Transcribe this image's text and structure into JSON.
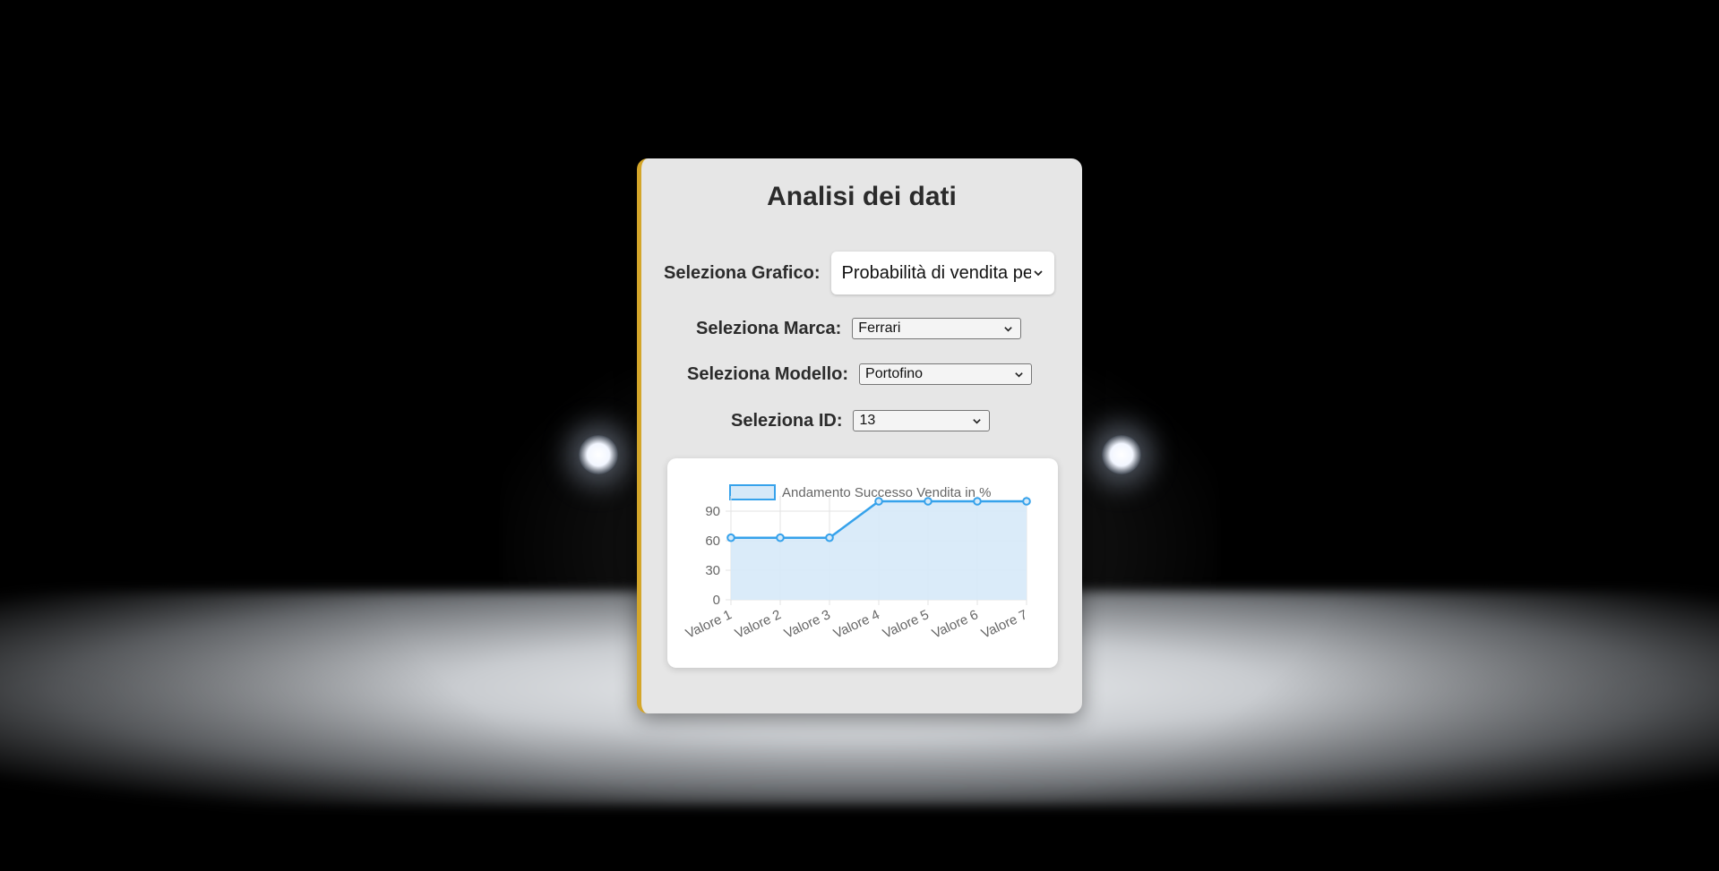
{
  "page": {
    "title": "Analisi dei dati"
  },
  "form": {
    "grafico": {
      "label": "Seleziona Grafico:",
      "value": "Probabilità di vendita pe"
    },
    "marca": {
      "label": "Seleziona Marca:",
      "value": "Ferrari"
    },
    "modello": {
      "label": "Seleziona Modello:",
      "value": "Portofino"
    },
    "id": {
      "label": "Seleziona ID:",
      "value": "13"
    }
  },
  "colors": {
    "accent": "#d4a62a",
    "line": "#36a2eb",
    "fill": "#d6e9f8"
  },
  "chart_data": {
    "type": "area",
    "categories": [
      "Valore 1",
      "Valore 2",
      "Valore 3",
      "Valore 4",
      "Valore 5",
      "Valore 6",
      "Valore 7"
    ],
    "series": [
      {
        "name": "Andamento Successo Vendita in %",
        "values": [
          63,
          63,
          63,
          100,
          100,
          100,
          100
        ]
      }
    ],
    "yticks": [
      "0",
      "30",
      "60",
      "90"
    ],
    "ylim": [
      0,
      100
    ],
    "legend": "top",
    "grid": true
  }
}
